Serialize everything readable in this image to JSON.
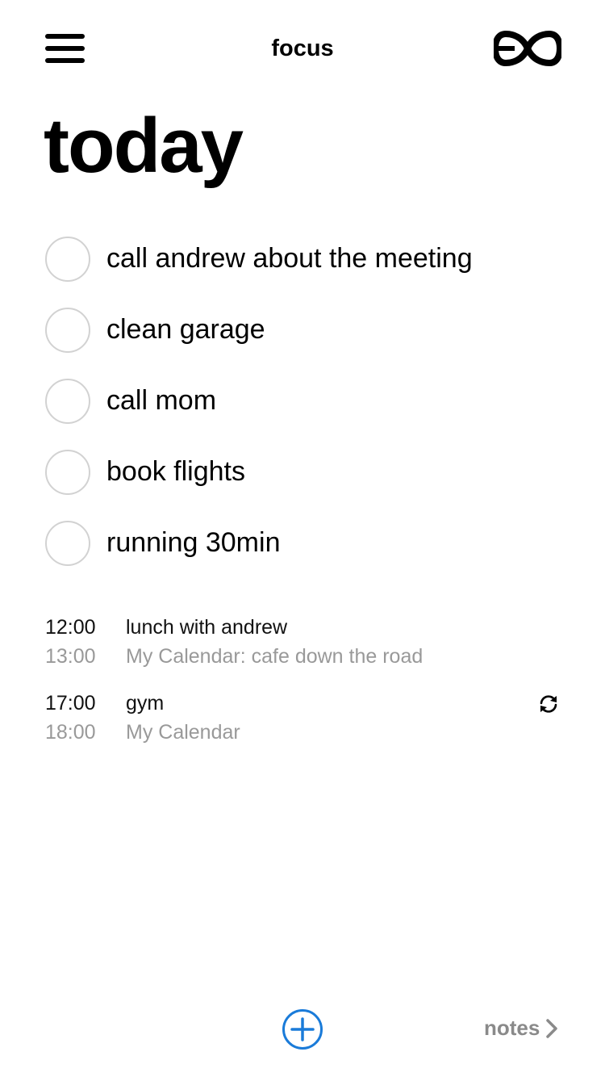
{
  "header": {
    "title": "focus",
    "menu_icon": "hamburger-menu-icon",
    "logo_icon": "infinity-logo-icon"
  },
  "page": {
    "title": "today"
  },
  "tasks": [
    {
      "label": "call andrew about the meeting",
      "done": false
    },
    {
      "label": "clean garage",
      "done": false
    },
    {
      "label": "call mom",
      "done": false
    },
    {
      "label": "book flights",
      "done": false
    },
    {
      "label": "running 30min",
      "done": false
    }
  ],
  "events": [
    {
      "start": "12:00",
      "title": "lunch with andrew",
      "end": "13:00",
      "detail": "My Calendar: cafe down the road",
      "recurring": false
    },
    {
      "start": "17:00",
      "title": "gym",
      "end": "18:00",
      "detail": "My Calendar",
      "recurring": true
    }
  ],
  "footer": {
    "add_icon": "plus-circle-icon",
    "notes_label": "notes",
    "notes_icon": "chevron-right-icon"
  },
  "colors": {
    "accent": "#1a7bd9",
    "checkbox_border": "#d2d2d2",
    "secondary_text": "#999999",
    "notes_text": "#8a8a8a"
  }
}
